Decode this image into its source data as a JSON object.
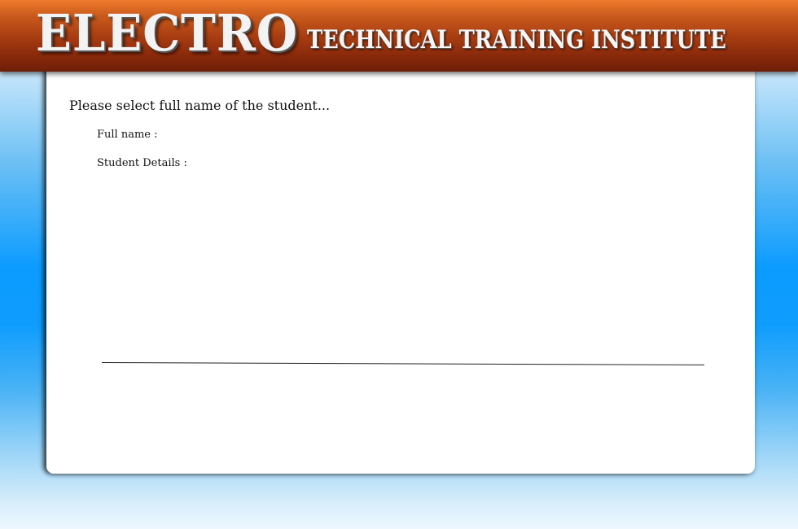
{
  "header": {
    "brand": "ELECTRO",
    "tagline": "TECHNICAL TRAINING INSTITUTE"
  },
  "form": {
    "prompt": "Please select full name of the student...",
    "full_name_label": "Full name :",
    "details_label": "Student Details :"
  },
  "colors": {
    "banner_top": "#ee7a2c",
    "banner_bottom": "#6d1f08",
    "background_accent": "#0b9bff",
    "panel": "#ffffff"
  }
}
